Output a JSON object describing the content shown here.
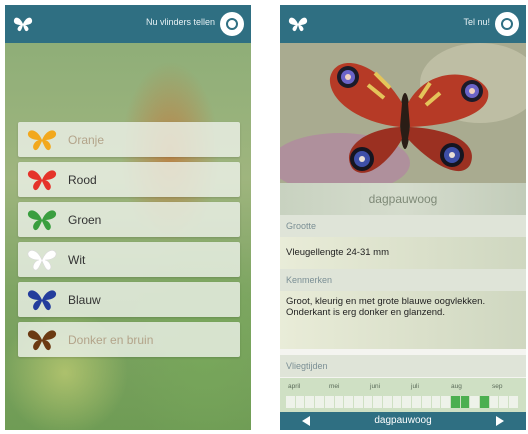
{
  "left_screen": {
    "header_action": "Nu vlinders tellen",
    "colors": [
      {
        "label": "Oranje",
        "color": "#f2a81d",
        "faded": true
      },
      {
        "label": "Rood",
        "color": "#e5332a",
        "faded": false
      },
      {
        "label": "Groen",
        "color": "#3a9e3f",
        "faded": false
      },
      {
        "label": "Wit",
        "color": "#ffffff",
        "faded": false
      },
      {
        "label": "Blauw",
        "color": "#233d9c",
        "faded": false
      },
      {
        "label": "Donker en bruin",
        "color": "#6b3a12",
        "faded": true
      }
    ]
  },
  "right_screen": {
    "header_action": "Tel nu!",
    "species_name": "dagpauwoog",
    "size_heading": "Grootte",
    "size_text": "Vleugellengte 24-31 mm",
    "features_heading": "Kenmerken",
    "features_text": "Groot, kleurig en met grote blauwe oogvlekken. Onderkant is erg donker en glanzend.",
    "flight_heading": "Vliegtijden",
    "months": [
      "april",
      "mei",
      "juni",
      "juli",
      "aug",
      "sep"
    ],
    "active_cells": [
      17,
      18,
      20
    ],
    "bottom_label": "dagpauwoog"
  },
  "icons": {
    "logo": "butterfly-logo-icon",
    "search": "search-icon",
    "prev": "arrow-left-icon",
    "next": "arrow-right-icon"
  }
}
